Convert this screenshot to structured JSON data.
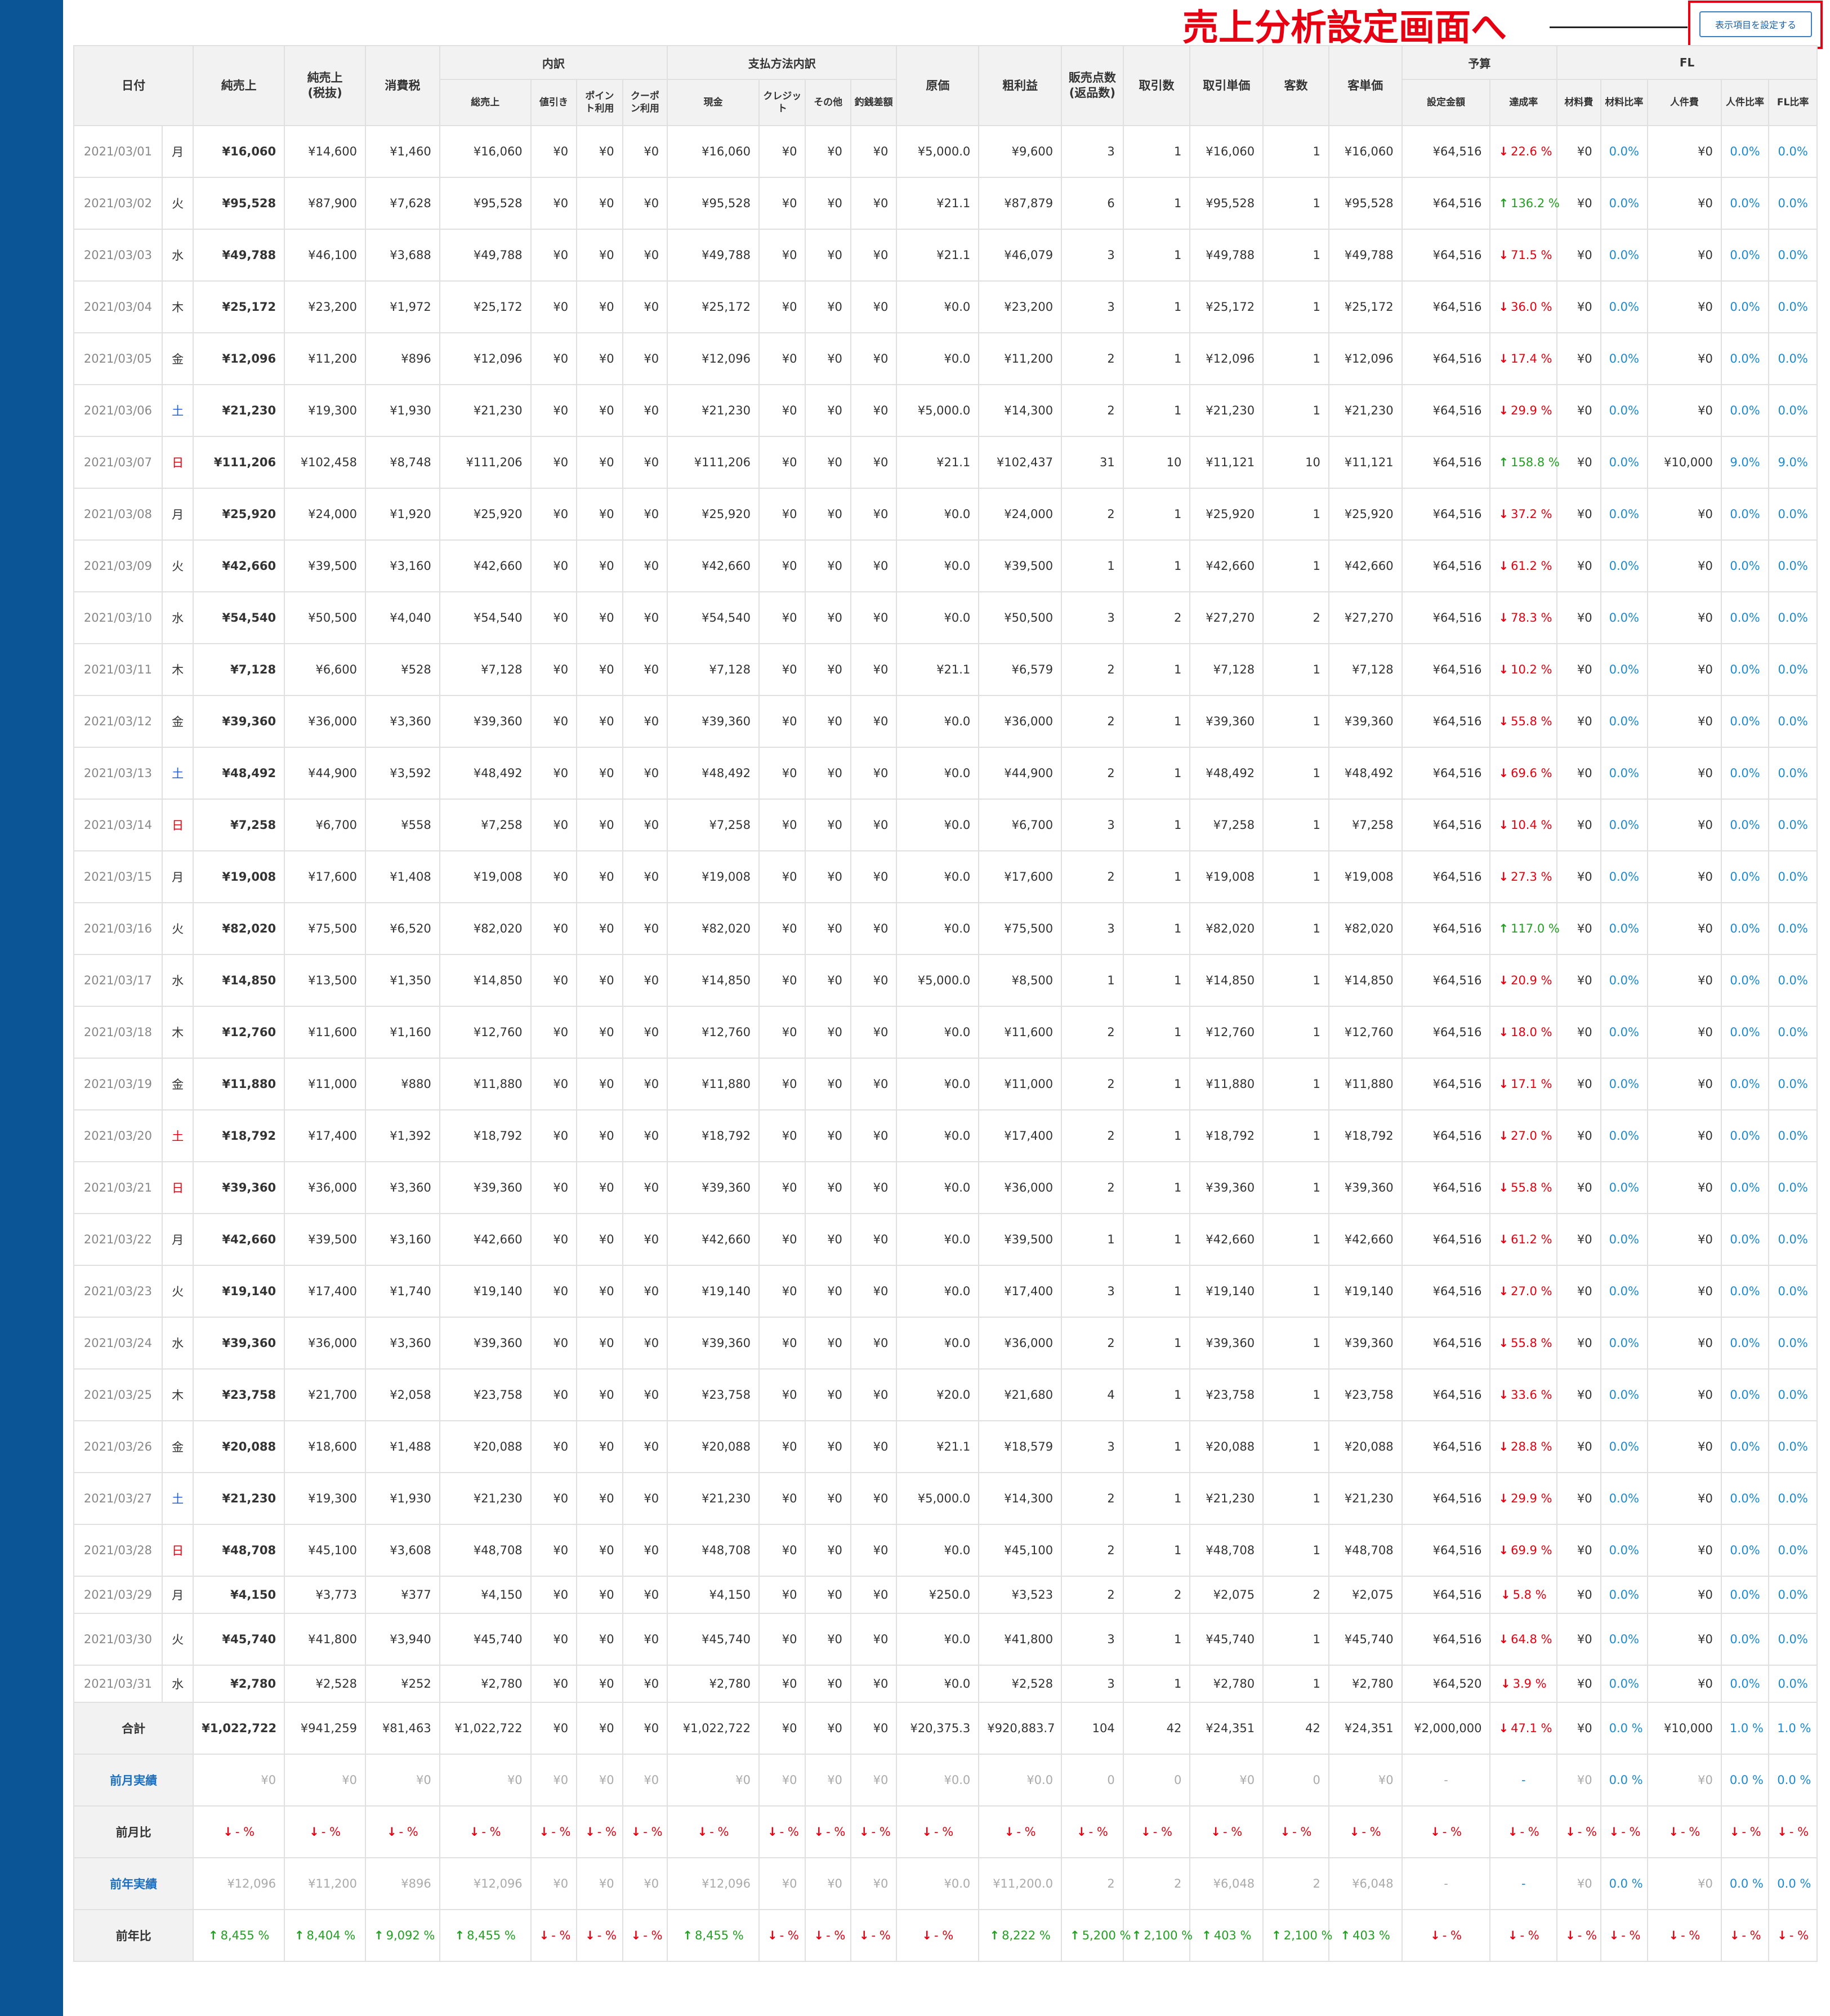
{
  "annotation": {
    "text": "売上分析設定画面へ"
  },
  "settings_button": {
    "label": "表示項目を設定する"
  },
  "headers": {
    "date": "日付",
    "net_sales": "純売上",
    "net_sales_ex_tax": "純売上\n(税抜)",
    "tax": "消費税",
    "breakdown": "内訳",
    "breakdown_total": "総売上",
    "breakdown_discount": "値引き",
    "breakdown_points": "ポイン\nト利用",
    "breakdown_coupon": "クーポ\nン利用",
    "payment": "支払方法内訳",
    "pay_cash": "現金",
    "pay_credit": "クレジッ\nト",
    "pay_other": "その他",
    "pay_change": "釣銭差額",
    "cost": "原価",
    "gross_profit": "粗利益",
    "items_sold": "販売点数\n(返品数)",
    "transactions": "取引数",
    "avg_transaction": "取引単価",
    "customers": "客数",
    "avg_customer": "客単価",
    "budget": "予算",
    "budget_amount": "設定金額",
    "achievement": "達成率",
    "fl": "FL",
    "material_cost": "材料費",
    "material_ratio": "材料比率",
    "labor_cost": "人件費",
    "labor_ratio": "人件比率",
    "fl_ratio": "FL比率"
  },
  "rows": [
    {
      "date": "2021/03/01",
      "dow": "月",
      "dt": "",
      "net": "¥16,060",
      "ex": "¥14,600",
      "tax": "¥1,460",
      "total": "¥16,060",
      "cash": "¥16,060",
      "cost": "¥5,000.0",
      "gross": "¥9,600",
      "items": "3",
      "trans": "1",
      "avg_t": "¥16,060",
      "cust": "1",
      "avg_c": "¥16,060",
      "budget": "¥64,516",
      "ach": "22.6 %",
      "ach_dir": "down",
      "labor": "¥0",
      "labor_r": "0.0%",
      "fl_r": "0.0%"
    },
    {
      "date": "2021/03/02",
      "dow": "火",
      "dt": "",
      "net": "¥95,528",
      "ex": "¥87,900",
      "tax": "¥7,628",
      "total": "¥95,528",
      "cash": "¥95,528",
      "cost": "¥21.1",
      "gross": "¥87,879",
      "items": "6",
      "trans": "1",
      "avg_t": "¥95,528",
      "cust": "1",
      "avg_c": "¥95,528",
      "budget": "¥64,516",
      "ach": "136.2 %",
      "ach_dir": "up",
      "labor": "¥0",
      "labor_r": "0.0%",
      "fl_r": "0.0%"
    },
    {
      "date": "2021/03/03",
      "dow": "水",
      "dt": "",
      "net": "¥49,788",
      "ex": "¥46,100",
      "tax": "¥3,688",
      "total": "¥49,788",
      "cash": "¥49,788",
      "cost": "¥21.1",
      "gross": "¥46,079",
      "items": "3",
      "trans": "1",
      "avg_t": "¥49,788",
      "cust": "1",
      "avg_c": "¥49,788",
      "budget": "¥64,516",
      "ach": "71.5 %",
      "ach_dir": "down",
      "labor": "¥0",
      "labor_r": "0.0%",
      "fl_r": "0.0%"
    },
    {
      "date": "2021/03/04",
      "dow": "木",
      "dt": "",
      "net": "¥25,172",
      "ex": "¥23,200",
      "tax": "¥1,972",
      "total": "¥25,172",
      "cash": "¥25,172",
      "cost": "¥0.0",
      "gross": "¥23,200",
      "items": "3",
      "trans": "1",
      "avg_t": "¥25,172",
      "cust": "1",
      "avg_c": "¥25,172",
      "budget": "¥64,516",
      "ach": "36.0 %",
      "ach_dir": "down",
      "labor": "¥0",
      "labor_r": "0.0%",
      "fl_r": "0.0%"
    },
    {
      "date": "2021/03/05",
      "dow": "金",
      "dt": "",
      "net": "¥12,096",
      "ex": "¥11,200",
      "tax": "¥896",
      "total": "¥12,096",
      "cash": "¥12,096",
      "cost": "¥0.0",
      "gross": "¥11,200",
      "items": "2",
      "trans": "1",
      "avg_t": "¥12,096",
      "cust": "1",
      "avg_c": "¥12,096",
      "budget": "¥64,516",
      "ach": "17.4 %",
      "ach_dir": "down",
      "labor": "¥0",
      "labor_r": "0.0%",
      "fl_r": "0.0%"
    },
    {
      "date": "2021/03/06",
      "dow": "土",
      "dt": "sat",
      "net": "¥21,230",
      "ex": "¥19,300",
      "tax": "¥1,930",
      "total": "¥21,230",
      "cash": "¥21,230",
      "cost": "¥5,000.0",
      "gross": "¥14,300",
      "items": "2",
      "trans": "1",
      "avg_t": "¥21,230",
      "cust": "1",
      "avg_c": "¥21,230",
      "budget": "¥64,516",
      "ach": "29.9 %",
      "ach_dir": "down",
      "labor": "¥0",
      "labor_r": "0.0%",
      "fl_r": "0.0%"
    },
    {
      "date": "2021/03/07",
      "dow": "日",
      "dt": "sun",
      "net": "¥111,206",
      "ex": "¥102,458",
      "tax": "¥8,748",
      "total": "¥111,206",
      "cash": "¥111,206",
      "cost": "¥21.1",
      "gross": "¥102,437",
      "items": "31",
      "trans": "10",
      "avg_t": "¥11,121",
      "cust": "10",
      "avg_c": "¥11,121",
      "budget": "¥64,516",
      "ach": "158.8 %",
      "ach_dir": "up",
      "labor": "¥10,000",
      "labor_r": "9.0%",
      "fl_r": "9.0%"
    },
    {
      "date": "2021/03/08",
      "dow": "月",
      "dt": "",
      "net": "¥25,920",
      "ex": "¥24,000",
      "tax": "¥1,920",
      "total": "¥25,920",
      "cash": "¥25,920",
      "cost": "¥0.0",
      "gross": "¥24,000",
      "items": "2",
      "trans": "1",
      "avg_t": "¥25,920",
      "cust": "1",
      "avg_c": "¥25,920",
      "budget": "¥64,516",
      "ach": "37.2 %",
      "ach_dir": "down",
      "labor": "¥0",
      "labor_r": "0.0%",
      "fl_r": "0.0%"
    },
    {
      "date": "2021/03/09",
      "dow": "火",
      "dt": "",
      "net": "¥42,660",
      "ex": "¥39,500",
      "tax": "¥3,160",
      "total": "¥42,660",
      "cash": "¥42,660",
      "cost": "¥0.0",
      "gross": "¥39,500",
      "items": "1",
      "trans": "1",
      "avg_t": "¥42,660",
      "cust": "1",
      "avg_c": "¥42,660",
      "budget": "¥64,516",
      "ach": "61.2 %",
      "ach_dir": "down",
      "labor": "¥0",
      "labor_r": "0.0%",
      "fl_r": "0.0%"
    },
    {
      "date": "2021/03/10",
      "dow": "水",
      "dt": "",
      "net": "¥54,540",
      "ex": "¥50,500",
      "tax": "¥4,040",
      "total": "¥54,540",
      "cash": "¥54,540",
      "cost": "¥0.0",
      "gross": "¥50,500",
      "items": "3",
      "trans": "2",
      "avg_t": "¥27,270",
      "cust": "2",
      "avg_c": "¥27,270",
      "budget": "¥64,516",
      "ach": "78.3 %",
      "ach_dir": "down",
      "labor": "¥0",
      "labor_r": "0.0%",
      "fl_r": "0.0%"
    },
    {
      "date": "2021/03/11",
      "dow": "木",
      "dt": "",
      "net": "¥7,128",
      "ex": "¥6,600",
      "tax": "¥528",
      "total": "¥7,128",
      "cash": "¥7,128",
      "cost": "¥21.1",
      "gross": "¥6,579",
      "items": "2",
      "trans": "1",
      "avg_t": "¥7,128",
      "cust": "1",
      "avg_c": "¥7,128",
      "budget": "¥64,516",
      "ach": "10.2 %",
      "ach_dir": "down",
      "labor": "¥0",
      "labor_r": "0.0%",
      "fl_r": "0.0%"
    },
    {
      "date": "2021/03/12",
      "dow": "金",
      "dt": "",
      "net": "¥39,360",
      "ex": "¥36,000",
      "tax": "¥3,360",
      "total": "¥39,360",
      "cash": "¥39,360",
      "cost": "¥0.0",
      "gross": "¥36,000",
      "items": "2",
      "trans": "1",
      "avg_t": "¥39,360",
      "cust": "1",
      "avg_c": "¥39,360",
      "budget": "¥64,516",
      "ach": "55.8 %",
      "ach_dir": "down",
      "labor": "¥0",
      "labor_r": "0.0%",
      "fl_r": "0.0%"
    },
    {
      "date": "2021/03/13",
      "dow": "土",
      "dt": "sat",
      "net": "¥48,492",
      "ex": "¥44,900",
      "tax": "¥3,592",
      "total": "¥48,492",
      "cash": "¥48,492",
      "cost": "¥0.0",
      "gross": "¥44,900",
      "items": "2",
      "trans": "1",
      "avg_t": "¥48,492",
      "cust": "1",
      "avg_c": "¥48,492",
      "budget": "¥64,516",
      "ach": "69.6 %",
      "ach_dir": "down",
      "labor": "¥0",
      "labor_r": "0.0%",
      "fl_r": "0.0%"
    },
    {
      "date": "2021/03/14",
      "dow": "日",
      "dt": "sun",
      "net": "¥7,258",
      "ex": "¥6,700",
      "tax": "¥558",
      "total": "¥7,258",
      "cash": "¥7,258",
      "cost": "¥0.0",
      "gross": "¥6,700",
      "items": "3",
      "trans": "1",
      "avg_t": "¥7,258",
      "cust": "1",
      "avg_c": "¥7,258",
      "budget": "¥64,516",
      "ach": "10.4 %",
      "ach_dir": "down",
      "labor": "¥0",
      "labor_r": "0.0%",
      "fl_r": "0.0%"
    },
    {
      "date": "2021/03/15",
      "dow": "月",
      "dt": "",
      "net": "¥19,008",
      "ex": "¥17,600",
      "tax": "¥1,408",
      "total": "¥19,008",
      "cash": "¥19,008",
      "cost": "¥0.0",
      "gross": "¥17,600",
      "items": "2",
      "trans": "1",
      "avg_t": "¥19,008",
      "cust": "1",
      "avg_c": "¥19,008",
      "budget": "¥64,516",
      "ach": "27.3 %",
      "ach_dir": "down",
      "labor": "¥0",
      "labor_r": "0.0%",
      "fl_r": "0.0%"
    },
    {
      "date": "2021/03/16",
      "dow": "火",
      "dt": "",
      "net": "¥82,020",
      "ex": "¥75,500",
      "tax": "¥6,520",
      "total": "¥82,020",
      "cash": "¥82,020",
      "cost": "¥0.0",
      "gross": "¥75,500",
      "items": "3",
      "trans": "1",
      "avg_t": "¥82,020",
      "cust": "1",
      "avg_c": "¥82,020",
      "budget": "¥64,516",
      "ach": "117.0 %",
      "ach_dir": "up",
      "labor": "¥0",
      "labor_r": "0.0%",
      "fl_r": "0.0%"
    },
    {
      "date": "2021/03/17",
      "dow": "水",
      "dt": "",
      "net": "¥14,850",
      "ex": "¥13,500",
      "tax": "¥1,350",
      "total": "¥14,850",
      "cash": "¥14,850",
      "cost": "¥5,000.0",
      "gross": "¥8,500",
      "items": "1",
      "trans": "1",
      "avg_t": "¥14,850",
      "cust": "1",
      "avg_c": "¥14,850",
      "budget": "¥64,516",
      "ach": "20.9 %",
      "ach_dir": "down",
      "labor": "¥0",
      "labor_r": "0.0%",
      "fl_r": "0.0%"
    },
    {
      "date": "2021/03/18",
      "dow": "木",
      "dt": "",
      "net": "¥12,760",
      "ex": "¥11,600",
      "tax": "¥1,160",
      "total": "¥12,760",
      "cash": "¥12,760",
      "cost": "¥0.0",
      "gross": "¥11,600",
      "items": "2",
      "trans": "1",
      "avg_t": "¥12,760",
      "cust": "1",
      "avg_c": "¥12,760",
      "budget": "¥64,516",
      "ach": "18.0 %",
      "ach_dir": "down",
      "labor": "¥0",
      "labor_r": "0.0%",
      "fl_r": "0.0%"
    },
    {
      "date": "2021/03/19",
      "dow": "金",
      "dt": "",
      "net": "¥11,880",
      "ex": "¥11,000",
      "tax": "¥880",
      "total": "¥11,880",
      "cash": "¥11,880",
      "cost": "¥0.0",
      "gross": "¥11,000",
      "items": "2",
      "trans": "1",
      "avg_t": "¥11,880",
      "cust": "1",
      "avg_c": "¥11,880",
      "budget": "¥64,516",
      "ach": "17.1 %",
      "ach_dir": "down",
      "labor": "¥0",
      "labor_r": "0.0%",
      "fl_r": "0.0%"
    },
    {
      "date": "2021/03/20",
      "dow": "土",
      "dt": "sun",
      "net": "¥18,792",
      "ex": "¥17,400",
      "tax": "¥1,392",
      "total": "¥18,792",
      "cash": "¥18,792",
      "cost": "¥0.0",
      "gross": "¥17,400",
      "items": "2",
      "trans": "1",
      "avg_t": "¥18,792",
      "cust": "1",
      "avg_c": "¥18,792",
      "budget": "¥64,516",
      "ach": "27.0 %",
      "ach_dir": "down",
      "labor": "¥0",
      "labor_r": "0.0%",
      "fl_r": "0.0%"
    },
    {
      "date": "2021/03/21",
      "dow": "日",
      "dt": "sun",
      "net": "¥39,360",
      "ex": "¥36,000",
      "tax": "¥3,360",
      "total": "¥39,360",
      "cash": "¥39,360",
      "cost": "¥0.0",
      "gross": "¥36,000",
      "items": "2",
      "trans": "1",
      "avg_t": "¥39,360",
      "cust": "1",
      "avg_c": "¥39,360",
      "budget": "¥64,516",
      "ach": "55.8 %",
      "ach_dir": "down",
      "labor": "¥0",
      "labor_r": "0.0%",
      "fl_r": "0.0%"
    },
    {
      "date": "2021/03/22",
      "dow": "月",
      "dt": "",
      "net": "¥42,660",
      "ex": "¥39,500",
      "tax": "¥3,160",
      "total": "¥42,660",
      "cash": "¥42,660",
      "cost": "¥0.0",
      "gross": "¥39,500",
      "items": "1",
      "trans": "1",
      "avg_t": "¥42,660",
      "cust": "1",
      "avg_c": "¥42,660",
      "budget": "¥64,516",
      "ach": "61.2 %",
      "ach_dir": "down",
      "labor": "¥0",
      "labor_r": "0.0%",
      "fl_r": "0.0%"
    },
    {
      "date": "2021/03/23",
      "dow": "火",
      "dt": "",
      "net": "¥19,140",
      "ex": "¥17,400",
      "tax": "¥1,740",
      "total": "¥19,140",
      "cash": "¥19,140",
      "cost": "¥0.0",
      "gross": "¥17,400",
      "items": "3",
      "trans": "1",
      "avg_t": "¥19,140",
      "cust": "1",
      "avg_c": "¥19,140",
      "budget": "¥64,516",
      "ach": "27.0 %",
      "ach_dir": "down",
      "labor": "¥0",
      "labor_r": "0.0%",
      "fl_r": "0.0%"
    },
    {
      "date": "2021/03/24",
      "dow": "水",
      "dt": "",
      "net": "¥39,360",
      "ex": "¥36,000",
      "tax": "¥3,360",
      "total": "¥39,360",
      "cash": "¥39,360",
      "cost": "¥0.0",
      "gross": "¥36,000",
      "items": "2",
      "trans": "1",
      "avg_t": "¥39,360",
      "cust": "1",
      "avg_c": "¥39,360",
      "budget": "¥64,516",
      "ach": "55.8 %",
      "ach_dir": "down",
      "labor": "¥0",
      "labor_r": "0.0%",
      "fl_r": "0.0%"
    },
    {
      "date": "2021/03/25",
      "dow": "木",
      "dt": "",
      "net": "¥23,758",
      "ex": "¥21,700",
      "tax": "¥2,058",
      "total": "¥23,758",
      "cash": "¥23,758",
      "cost": "¥20.0",
      "gross": "¥21,680",
      "items": "4",
      "trans": "1",
      "avg_t": "¥23,758",
      "cust": "1",
      "avg_c": "¥23,758",
      "budget": "¥64,516",
      "ach": "33.6 %",
      "ach_dir": "down",
      "labor": "¥0",
      "labor_r": "0.0%",
      "fl_r": "0.0%"
    },
    {
      "date": "2021/03/26",
      "dow": "金",
      "dt": "",
      "net": "¥20,088",
      "ex": "¥18,600",
      "tax": "¥1,488",
      "total": "¥20,088",
      "cash": "¥20,088",
      "cost": "¥21.1",
      "gross": "¥18,579",
      "items": "3",
      "trans": "1",
      "avg_t": "¥20,088",
      "cust": "1",
      "avg_c": "¥20,088",
      "budget": "¥64,516",
      "ach": "28.8 %",
      "ach_dir": "down",
      "labor": "¥0",
      "labor_r": "0.0%",
      "fl_r": "0.0%"
    },
    {
      "date": "2021/03/27",
      "dow": "土",
      "dt": "sat",
      "net": "¥21,230",
      "ex": "¥19,300",
      "tax": "¥1,930",
      "total": "¥21,230",
      "cash": "¥21,230",
      "cost": "¥5,000.0",
      "gross": "¥14,300",
      "items": "2",
      "trans": "1",
      "avg_t": "¥21,230",
      "cust": "1",
      "avg_c": "¥21,230",
      "budget": "¥64,516",
      "ach": "29.9 %",
      "ach_dir": "down",
      "labor": "¥0",
      "labor_r": "0.0%",
      "fl_r": "0.0%"
    },
    {
      "date": "2021/03/28",
      "dow": "日",
      "dt": "sun",
      "net": "¥48,708",
      "ex": "¥45,100",
      "tax": "¥3,608",
      "total": "¥48,708",
      "cash": "¥48,708",
      "cost": "¥0.0",
      "gross": "¥45,100",
      "items": "2",
      "trans": "1",
      "avg_t": "¥48,708",
      "cust": "1",
      "avg_c": "¥48,708",
      "budget": "¥64,516",
      "ach": "69.9 %",
      "ach_dir": "down",
      "labor": "¥0",
      "labor_r": "0.0%",
      "fl_r": "0.0%"
    },
    {
      "date": "2021/03/29",
      "dow": "月",
      "dt": "",
      "net": "¥4,150",
      "ex": "¥3,773",
      "tax": "¥377",
      "total": "¥4,150",
      "cash": "¥4,150",
      "cost": "¥250.0",
      "gross": "¥3,523",
      "items": "2",
      "trans": "2",
      "avg_t": "¥2,075",
      "cust": "2",
      "avg_c": "¥2,075",
      "budget": "¥64,516",
      "ach": "5.8 %",
      "ach_dir": "down",
      "labor": "¥0",
      "labor_r": "0.0%",
      "fl_r": "0.0%",
      "short": true
    },
    {
      "date": "2021/03/30",
      "dow": "火",
      "dt": "",
      "net": "¥45,740",
      "ex": "¥41,800",
      "tax": "¥3,940",
      "total": "¥45,740",
      "cash": "¥45,740",
      "cost": "¥0.0",
      "gross": "¥41,800",
      "items": "3",
      "trans": "1",
      "avg_t": "¥45,740",
      "cust": "1",
      "avg_c": "¥45,740",
      "budget": "¥64,516",
      "ach": "64.8 %",
      "ach_dir": "down",
      "labor": "¥0",
      "labor_r": "0.0%",
      "fl_r": "0.0%"
    },
    {
      "date": "2021/03/31",
      "dow": "水",
      "dt": "",
      "net": "¥2,780",
      "ex": "¥2,528",
      "tax": "¥252",
      "total": "¥2,780",
      "cash": "¥2,780",
      "cost": "¥0.0",
      "gross": "¥2,528",
      "items": "3",
      "trans": "1",
      "avg_t": "¥2,780",
      "cust": "1",
      "avg_c": "¥2,780",
      "budget": "¥64,520",
      "ach": "3.9 %",
      "ach_dir": "down",
      "labor": "¥0",
      "labor_r": "0.0%",
      "fl_r": "0.0%",
      "short": true
    }
  ],
  "zero": "¥0",
  "zero_pct": "0.0%",
  "totals": {
    "label": "合計",
    "net": "¥1,022,722",
    "ex": "¥941,259",
    "tax": "¥81,463",
    "total": "¥1,022,722",
    "cash": "¥1,022,722",
    "cost": "¥20,375.3",
    "gross": "¥920,883.7",
    "items": "104",
    "trans": "42",
    "avg_t": "¥24,351",
    "cust": "42",
    "avg_c": "¥24,351",
    "budget": "¥2,000,000",
    "ach": "47.1 %",
    "mat_r": "0.0 %",
    "labor": "¥10,000",
    "labor_r": "1.0 %",
    "fl_r": "1.0 %"
  },
  "prev_month": {
    "label": "前月実績",
    "zero": "¥0",
    "cost": "¥0.0",
    "gross": "¥0.0",
    "num_zero": "0",
    "dash": "-",
    "pct": "0.0 %"
  },
  "prev_month_ratio": {
    "label": "前月比",
    "value": "- %"
  },
  "prev_year": {
    "label": "前年実績",
    "net": "¥12,096",
    "ex": "¥11,200",
    "tax": "¥896",
    "total": "¥12,096",
    "cash": "¥12,096",
    "cost": "¥0.0",
    "gross": "¥11,200.0",
    "items": "2",
    "trans": "2",
    "avg_t": "¥6,048",
    "cust": "2",
    "avg_c": "¥6,048",
    "dash": "-",
    "zero": "¥0",
    "pct": "0.0 %"
  },
  "prev_year_ratio": {
    "label": "前年比",
    "net": "8,455 %",
    "ex": "8,404 %",
    "tax": "9,092 %",
    "total": "8,455 %",
    "cash": "8,455 %",
    "gross": "8,222 %",
    "items": "5,200 %",
    "trans": "2,100 %",
    "avg_t": "403 %",
    "cust": "2,100 %",
    "avg_c": "403 %",
    "dash": "- %"
  }
}
